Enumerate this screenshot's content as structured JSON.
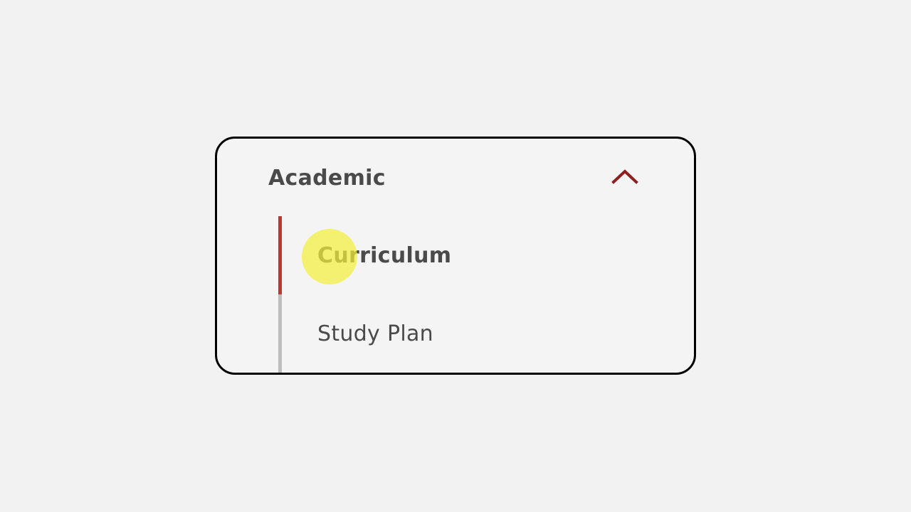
{
  "accordion": {
    "section_title": "Academic",
    "expanded": true,
    "toggle_icon": "chevron-up-icon",
    "items": [
      {
        "label": "Curriculum",
        "active": true
      },
      {
        "label": "Study Plan",
        "active": false
      }
    ]
  },
  "colors": {
    "accent": "#b83a33",
    "chevron": "#8f1f1f",
    "text": "#4a4a4a",
    "inactive_bar": "#bdbdbd",
    "card_border": "#000000",
    "page_background": "#f2f2f2",
    "cursor_highlight": "#f3f03c"
  }
}
